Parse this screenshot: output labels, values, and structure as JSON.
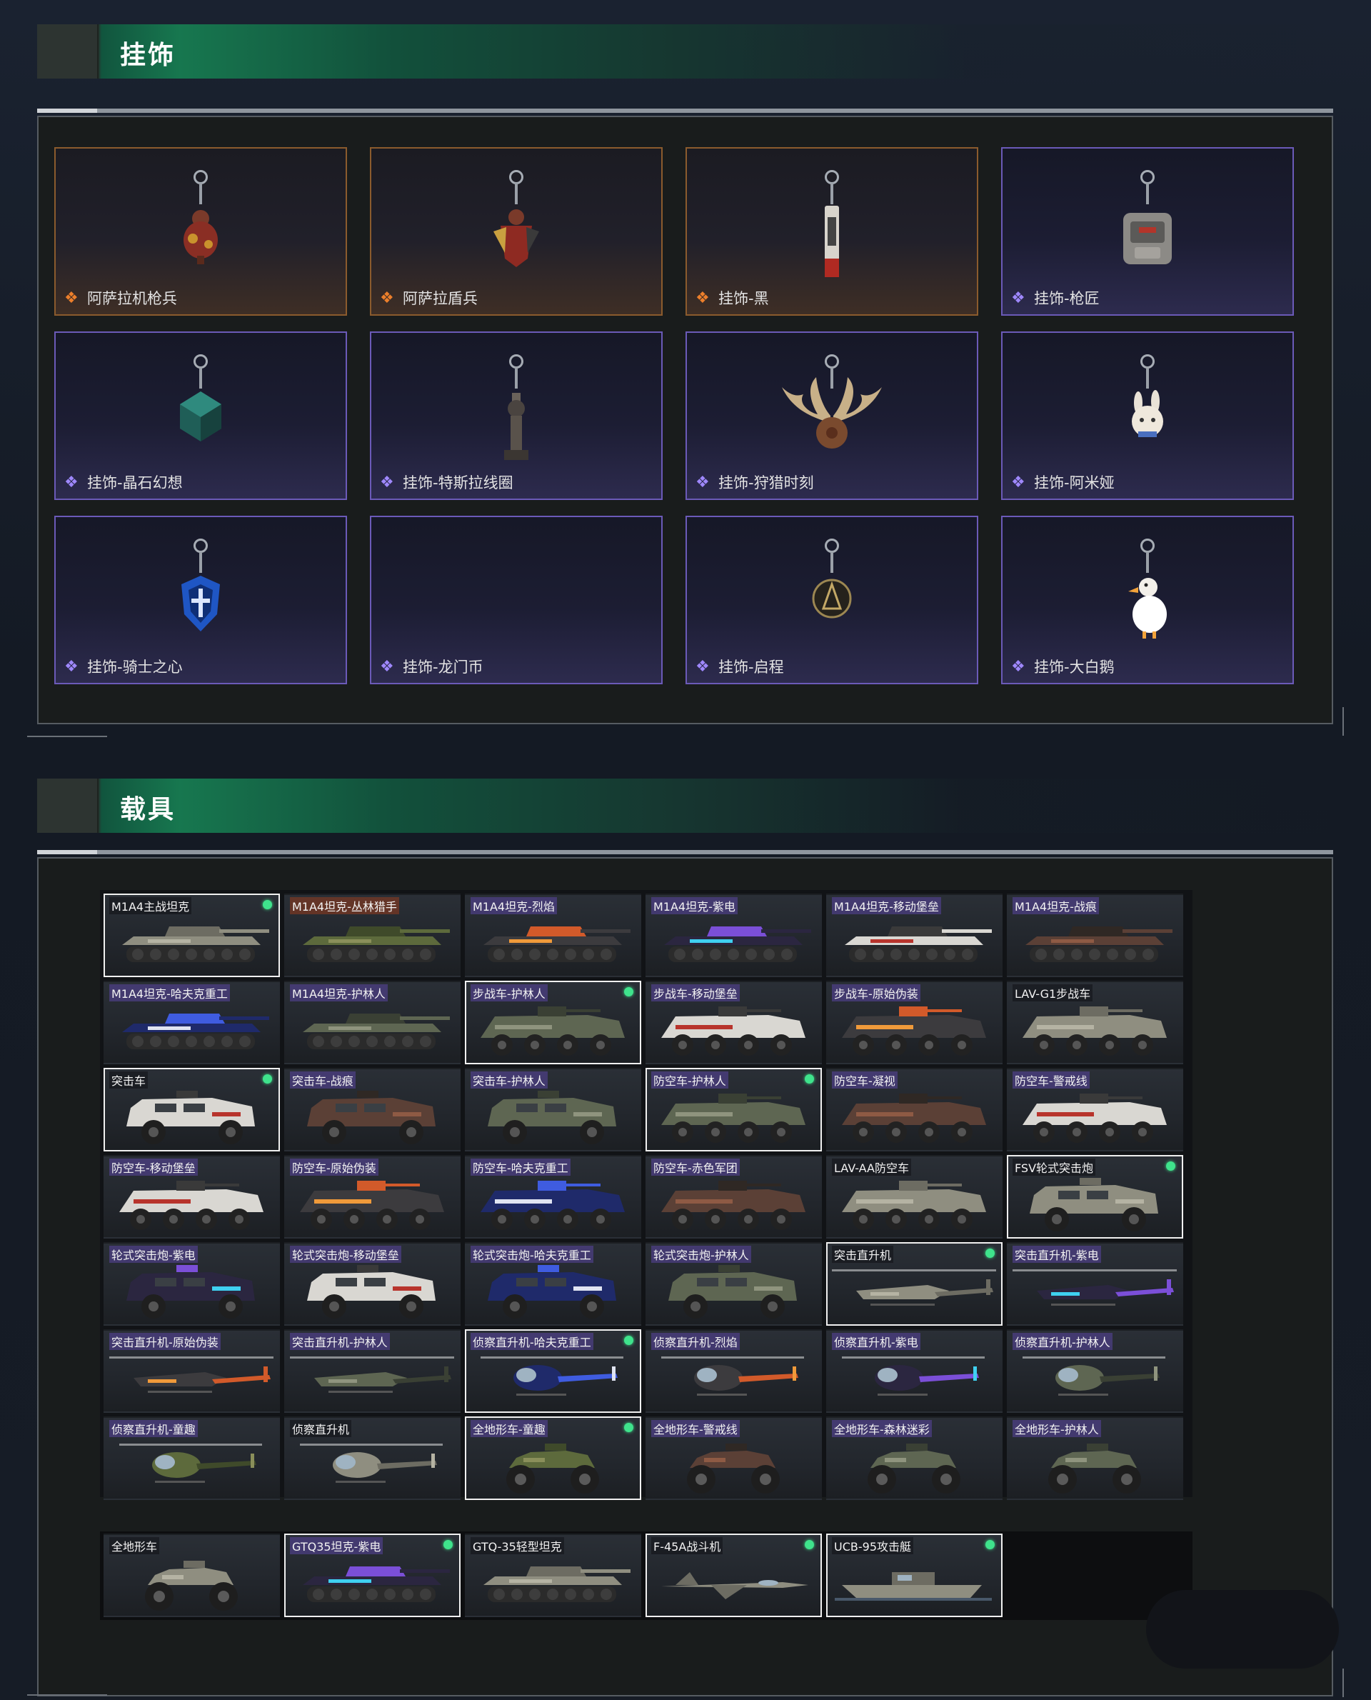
{
  "sections": {
    "charms_title": "挂饰",
    "vehicles_title": "载具"
  },
  "charms": [
    {
      "name": "阿萨拉机枪兵",
      "rarity": "orange",
      "rarity_icon": "diamond-orange-icon",
      "art": "warrior-charm"
    },
    {
      "name": "阿萨拉盾兵",
      "rarity": "orange",
      "rarity_icon": "diamond-orange-icon",
      "art": "shield-warrior-charm"
    },
    {
      "name": "挂饰-黑",
      "rarity": "orange",
      "rarity_icon": "diamond-orange-icon",
      "art": "tag-charm"
    },
    {
      "name": "挂饰-枪匠",
      "rarity": "purple",
      "rarity_icon": "diamond-purple-icon",
      "art": "backpack-charm"
    },
    {
      "name": "挂饰-晶石幻想",
      "rarity": "purple",
      "rarity_icon": "diamond-purple-icon",
      "art": "crystal-cube-charm"
    },
    {
      "name": "挂饰-特斯拉线圈",
      "rarity": "purple",
      "rarity_icon": "diamond-purple-icon",
      "art": "tesla-coil-charm"
    },
    {
      "name": "挂饰-狩猎时刻",
      "rarity": "purple",
      "rarity_icon": "diamond-purple-icon",
      "art": "antlers-charm"
    },
    {
      "name": "挂饰-阿米娅",
      "rarity": "purple",
      "rarity_icon": "diamond-purple-icon",
      "art": "bunny-charm"
    },
    {
      "name": "挂饰-骑士之心",
      "rarity": "purple",
      "rarity_icon": "diamond-purple-icon",
      "art": "knight-shield-charm"
    },
    {
      "name": "挂饰-龙门币",
      "rarity": "purple",
      "rarity_icon": "diamond-purple-icon",
      "art": "coin-charm"
    },
    {
      "name": "挂饰-启程",
      "rarity": "purple",
      "rarity_icon": "diamond-purple-icon",
      "art": "medal-charm"
    },
    {
      "name": "挂饰-大白鹅",
      "rarity": "purple",
      "rarity_icon": "diamond-purple-icon",
      "art": "goose-charm"
    }
  ],
  "vehicles": [
    {
      "name": "M1A4主战坦克",
      "type": "tank",
      "selected": true,
      "owned": true,
      "tint": "grey",
      "label": "plain"
    },
    {
      "name": "M1A4坦克-丛林猎手",
      "type": "tank",
      "selected": false,
      "owned": false,
      "tint": "green",
      "label": "orange"
    },
    {
      "name": "M1A4坦克-烈焰",
      "type": "tank",
      "selected": false,
      "owned": false,
      "tint": "flame",
      "label": "purple"
    },
    {
      "name": "M1A4坦克-紫电",
      "type": "tank",
      "selected": false,
      "owned": false,
      "tint": "violet",
      "label": "purple"
    },
    {
      "name": "M1A4坦克-移动堡垒",
      "type": "tank",
      "selected": false,
      "owned": false,
      "tint": "white",
      "label": "purple"
    },
    {
      "name": "M1A4坦克-战痕",
      "type": "tank",
      "selected": false,
      "owned": false,
      "tint": "rust",
      "label": "purple"
    },
    {
      "name": "M1A4坦克-哈夫克重工",
      "type": "tank",
      "selected": false,
      "owned": false,
      "tint": "blue",
      "label": "purple"
    },
    {
      "name": "M1A4坦克-护林人",
      "type": "tank",
      "selected": false,
      "owned": false,
      "tint": "camo",
      "label": "purple"
    },
    {
      "name": "步战车-护林人",
      "type": "ifv",
      "selected": true,
      "owned": true,
      "tint": "camo",
      "label": "purple"
    },
    {
      "name": "步战车-移动堡垒",
      "type": "ifv",
      "selected": false,
      "owned": false,
      "tint": "white",
      "label": "purple"
    },
    {
      "name": "步战车-原始伪装",
      "type": "ifv",
      "selected": false,
      "owned": false,
      "tint": "flame",
      "label": "purple"
    },
    {
      "name": "LAV-G1步战车",
      "type": "ifv",
      "selected": false,
      "owned": false,
      "tint": "grey",
      "label": "plain"
    },
    {
      "name": "突击车",
      "type": "truck",
      "selected": true,
      "owned": true,
      "tint": "white",
      "label": "plain"
    },
    {
      "name": "突击车-战痕",
      "type": "truck",
      "selected": false,
      "owned": false,
      "tint": "rust",
      "label": "purple"
    },
    {
      "name": "突击车-护林人",
      "type": "truck",
      "selected": false,
      "owned": false,
      "tint": "camo",
      "label": "purple"
    },
    {
      "name": "防空车-护林人",
      "type": "ifv",
      "selected": true,
      "owned": true,
      "tint": "camo",
      "label": "purple"
    },
    {
      "name": "防空车-凝视",
      "type": "ifv",
      "selected": false,
      "owned": false,
      "tint": "rust",
      "label": "purple"
    },
    {
      "name": "防空车-警戒线",
      "type": "ifv",
      "selected": false,
      "owned": false,
      "tint": "white",
      "label": "purple"
    },
    {
      "name": "防空车-移动堡垒",
      "type": "ifv",
      "selected": false,
      "owned": false,
      "tint": "white",
      "label": "purple"
    },
    {
      "name": "防空车-原始伪装",
      "type": "ifv",
      "selected": false,
      "owned": false,
      "tint": "flame",
      "label": "purple"
    },
    {
      "name": "防空车-哈夫克重工",
      "type": "ifv",
      "selected": false,
      "owned": false,
      "tint": "blue",
      "label": "purple"
    },
    {
      "name": "防空车-赤色军团",
      "type": "ifv",
      "selected": false,
      "owned": false,
      "tint": "rust",
      "label": "purple"
    },
    {
      "name": "LAV-AA防空车",
      "type": "ifv",
      "selected": false,
      "owned": false,
      "tint": "grey",
      "label": "plain"
    },
    {
      "name": "FSV轮式突击炮",
      "type": "truck",
      "selected": true,
      "owned": true,
      "tint": "grey",
      "label": "plain"
    },
    {
      "name": "轮式突击炮-紫电",
      "type": "truck",
      "selected": false,
      "owned": false,
      "tint": "violet",
      "label": "purple"
    },
    {
      "name": "轮式突击炮-移动堡垒",
      "type": "truck",
      "selected": false,
      "owned": false,
      "tint": "white",
      "label": "purple"
    },
    {
      "name": "轮式突击炮-哈夫克重工",
      "type": "truck",
      "selected": false,
      "owned": false,
      "tint": "blue",
      "label": "purple"
    },
    {
      "name": "轮式突击炮-护林人",
      "type": "truck",
      "selected": false,
      "owned": false,
      "tint": "camo",
      "label": "purple"
    },
    {
      "name": "突击直升机",
      "type": "heli",
      "selected": true,
      "owned": true,
      "tint": "grey",
      "label": "plain"
    },
    {
      "name": "突击直升机-紫电",
      "type": "heli",
      "selected": false,
      "owned": false,
      "tint": "violet",
      "label": "purple"
    },
    {
      "name": "突击直升机-原始伪装",
      "type": "heli",
      "selected": false,
      "owned": false,
      "tint": "flame",
      "label": "purple"
    },
    {
      "name": "突击直升机-护林人",
      "type": "heli",
      "selected": false,
      "owned": false,
      "tint": "camo",
      "label": "purple"
    },
    {
      "name": "侦察直升机-哈夫克重工",
      "type": "littlebird",
      "selected": true,
      "owned": true,
      "tint": "blue",
      "label": "purple"
    },
    {
      "name": "侦察直升机-烈焰",
      "type": "littlebird",
      "selected": false,
      "owned": false,
      "tint": "flame",
      "label": "purple"
    },
    {
      "name": "侦察直升机-紫电",
      "type": "littlebird",
      "selected": false,
      "owned": false,
      "tint": "violet",
      "label": "purple"
    },
    {
      "name": "侦察直升机-护林人",
      "type": "littlebird",
      "selected": false,
      "owned": false,
      "tint": "camo",
      "label": "purple"
    },
    {
      "name": "侦察直升机-童趣",
      "type": "littlebird",
      "selected": false,
      "owned": false,
      "tint": "green",
      "label": "purple"
    },
    {
      "name": "侦察直升机",
      "type": "littlebird",
      "selected": false,
      "owned": false,
      "tint": "grey",
      "label": "plain"
    },
    {
      "name": "全地形车-童趣",
      "type": "atv",
      "selected": true,
      "owned": true,
      "tint": "green",
      "label": "purple"
    },
    {
      "name": "全地形车-警戒线",
      "type": "atv",
      "selected": false,
      "owned": false,
      "tint": "rust",
      "label": "purple"
    },
    {
      "name": "全地形车-森林迷彩",
      "type": "atv",
      "selected": false,
      "owned": false,
      "tint": "camo",
      "label": "purple"
    },
    {
      "name": "全地形车-护林人",
      "type": "atv",
      "selected": false,
      "owned": false,
      "tint": "camo",
      "label": "purple"
    }
  ],
  "extra_vehicles": [
    {
      "name": "全地形车",
      "type": "atv",
      "selected": false,
      "owned": false,
      "tint": "grey",
      "label": "plain"
    },
    {
      "name": "GTQ35坦克-紫电",
      "type": "tank",
      "selected": true,
      "owned": true,
      "tint": "violet",
      "label": "purple"
    },
    {
      "name": "GTQ-35轻型坦克",
      "type": "tank",
      "selected": false,
      "owned": false,
      "tint": "grey",
      "label": "plain"
    },
    {
      "name": "F-45A战斗机",
      "type": "jet",
      "selected": true,
      "owned": true,
      "tint": "grey",
      "label": "plain"
    },
    {
      "name": "UCB-95攻击艇",
      "type": "boat",
      "selected": true,
      "owned": true,
      "tint": "grey",
      "label": "plain"
    }
  ],
  "colors": {
    "owned_dot": "#3fe38c",
    "rarity_orange": "#ec7f2b",
    "rarity_purple": "#9f88ff",
    "header_green": "#17774f"
  }
}
